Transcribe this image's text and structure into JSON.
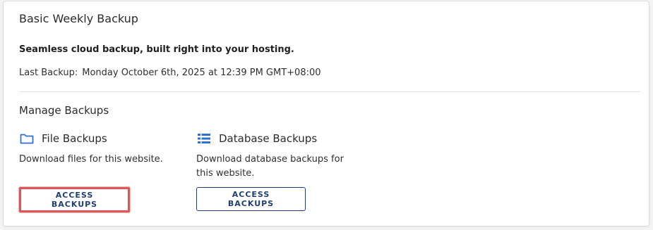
{
  "card": {
    "title": "Basic Weekly Backup",
    "tagline": "Seamless cloud backup, built right into your hosting.",
    "last_backup_label": "Last Backup:",
    "last_backup_value": "Monday October 6th, 2025 at 12:39 PM GMT+08:00"
  },
  "manage": {
    "title": "Manage Backups",
    "files": {
      "icon": "folder-icon",
      "label": "File Backups",
      "description": "Download files for this website.",
      "button": "ACCESS BACKUPS"
    },
    "database": {
      "icon": "list-icon",
      "label": "Database Backups",
      "description": "Download database backups for this website.",
      "button": "ACCESS BACKUPS"
    }
  },
  "colors": {
    "accent": "#1f3f73",
    "icon": "#2f6fd6",
    "highlight": "#e05555"
  }
}
